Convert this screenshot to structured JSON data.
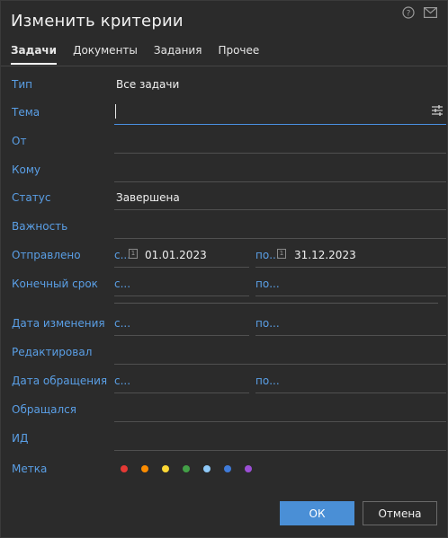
{
  "dialog": {
    "title": "Изменить критерии",
    "icons": [
      "help-icon",
      "mail-icon"
    ]
  },
  "tabs": [
    {
      "label": "Задачи",
      "active": true
    },
    {
      "label": "Документы",
      "active": false
    },
    {
      "label": "Задания",
      "active": false
    },
    {
      "label": "Прочее",
      "active": false
    }
  ],
  "fields": {
    "type": {
      "label": "Тип",
      "value": "Все задачи"
    },
    "subject": {
      "label": "Тема",
      "value": ""
    },
    "from": {
      "label": "От",
      "value": ""
    },
    "to": {
      "label": "Кому",
      "value": ""
    },
    "status": {
      "label": "Статус",
      "value": "Завершена"
    },
    "importance": {
      "label": "Важность",
      "value": ""
    },
    "sent": {
      "label": "Отправлено",
      "from_prefix": "с...",
      "from_date": "01.01.2023",
      "to_prefix": "по...",
      "to_date": "31.12.2023"
    },
    "due": {
      "label": "Конечный срок",
      "from_prefix": "с...",
      "to_prefix": "по..."
    },
    "modified": {
      "label": "Дата изменения",
      "from_prefix": "с...",
      "to_prefix": "по..."
    },
    "editor": {
      "label": "Редактировал",
      "value": ""
    },
    "accessed": {
      "label": "Дата обращения",
      "from_prefix": "с...",
      "to_prefix": "по..."
    },
    "accessor": {
      "label": "Обращался",
      "value": ""
    },
    "id": {
      "label": "ИД",
      "value": ""
    },
    "tag": {
      "label": "Метка"
    }
  },
  "calendar_glyph": "1",
  "tag_colors": [
    "#e53935",
    "#fb8c00",
    "#fdd835",
    "#43a047",
    "#90caf9",
    "#3f7bd9",
    "#9c4fd6"
  ],
  "buttons": {
    "ok": "ОК",
    "cancel": "Отмена"
  }
}
